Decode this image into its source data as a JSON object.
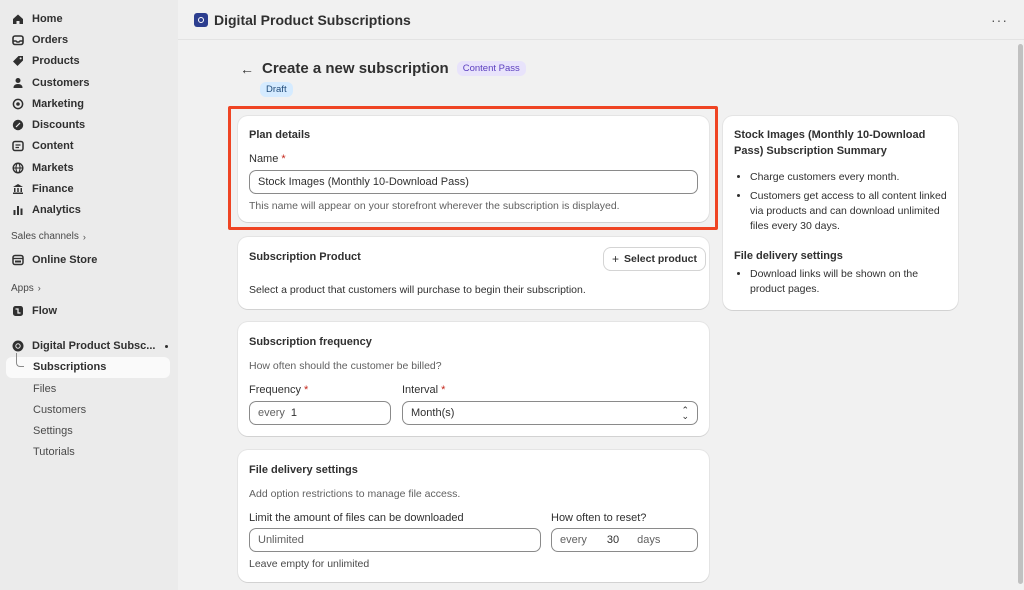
{
  "sidebar": {
    "nav": [
      {
        "label": "Home",
        "icon": "home-icon"
      },
      {
        "label": "Orders",
        "icon": "inbox-icon"
      },
      {
        "label": "Products",
        "icon": "tag-icon"
      },
      {
        "label": "Customers",
        "icon": "person-icon"
      },
      {
        "label": "Marketing",
        "icon": "target-icon"
      },
      {
        "label": "Discounts",
        "icon": "discount-icon"
      },
      {
        "label": "Content",
        "icon": "content-icon"
      },
      {
        "label": "Markets",
        "icon": "globe-icon"
      },
      {
        "label": "Finance",
        "icon": "bank-icon"
      },
      {
        "label": "Analytics",
        "icon": "bar-chart-icon"
      }
    ],
    "sales_channels_label": "Sales channels",
    "online_store": "Online Store",
    "apps_label": "Apps",
    "flow": "Flow",
    "app_name": "Digital Product Subsc...",
    "app_sub": [
      "Subscriptions",
      "Files",
      "Customers",
      "Settings",
      "Tutorials"
    ]
  },
  "topbar": {
    "title": "Digital Product Subscriptions",
    "more": "···"
  },
  "header": {
    "title": "Create a new subscription",
    "badge": "Content Pass",
    "status": "Draft"
  },
  "plan": {
    "title": "Plan details",
    "name_label": "Name",
    "required": "*",
    "name_value": "Stock Images (Monthly 10-Download Pass)",
    "help": "This name will appear on your storefront wherever the subscription is displayed."
  },
  "product": {
    "title": "Subscription Product",
    "button": "Select product",
    "desc": "Select a product that customers will purchase to begin their subscription."
  },
  "frequency": {
    "title": "Subscription frequency",
    "desc": "How often should the customer be billed?",
    "frequency_label": "Frequency",
    "frequency_prefix": "every",
    "frequency_value": "1",
    "interval_label": "Interval",
    "interval_value": "Month(s)"
  },
  "files": {
    "title": "File delivery settings",
    "desc": "Add option restrictions to manage file access.",
    "limit_label": "Limit the amount of files can be downloaded",
    "limit_placeholder": "Unlimited",
    "limit_help": "Leave empty for unlimited",
    "reset_label": "How often to reset?",
    "reset_prefix": "every",
    "reset_value": "30",
    "reset_suffix": "days"
  },
  "summary": {
    "title": "Stock Images (Monthly 10-Download Pass) Subscription Summary",
    "items": [
      "Charge customers every month.",
      "Customers get access to all content linked via products and can download unlimited files every 30 days."
    ],
    "file_title": "File delivery settings",
    "file_items": [
      "Download links will be shown on the product pages."
    ]
  }
}
